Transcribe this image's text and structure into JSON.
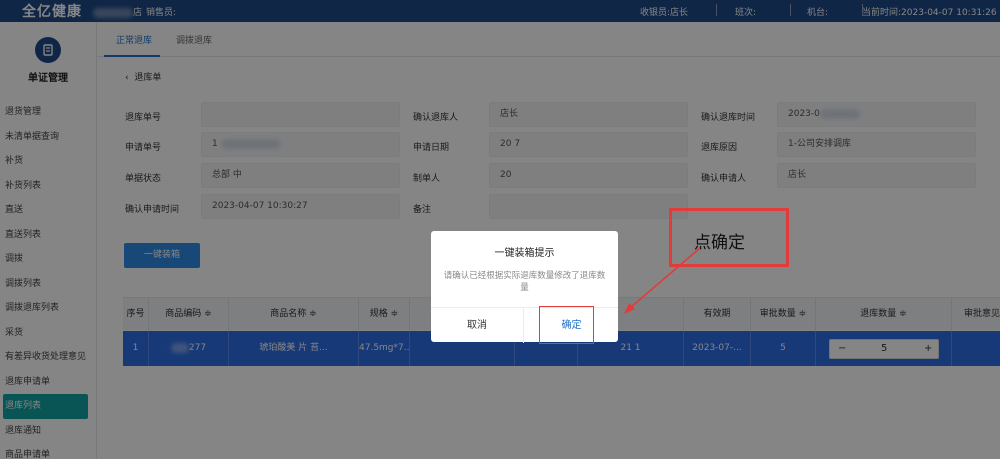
{
  "topbar": {
    "logo": "全亿健康",
    "store_suffix": "店",
    "sales_label": "销售员:",
    "cashier_label": "收银员:",
    "cashier_value": "店长",
    "shift_label": "班次:",
    "terminal_label": "机台:",
    "time_label": "当前时间:",
    "time_value": "2023-04-07 10:31:26"
  },
  "sidebar": {
    "title": "单证管理",
    "items": [
      "退货管理",
      "未清单据查询",
      "补货",
      "补货列表",
      "直送",
      "直送列表",
      "调拨",
      "调拨列表",
      "调拨退库列表",
      "采货",
      "有差异收货处理意见",
      "退库申请单",
      "退库列表",
      "退库通知",
      "商品申请单"
    ],
    "active_index": 12
  },
  "tabs": [
    "正常退库",
    "调拨退库"
  ],
  "back_label": "退库单",
  "form": {
    "return_no_label": "退库单号",
    "return_no_value": "",
    "confirm_person_label": "确认退库人",
    "confirm_person_value": "店长",
    "confirm_time_label": "确认退库时间",
    "confirm_time_value": "2023-0",
    "apply_no_label": "申请单号",
    "apply_no_value": "1",
    "apply_date_label": "申请日期",
    "apply_date_value": "20          7",
    "reason_label": "退库原因",
    "reason_value": "1-公司安排调库",
    "status_label": "单据状态",
    "status_value": "总部          中",
    "maker_label": "制单人",
    "maker_value": "20",
    "confirm_applicant_label": "确认申请人",
    "confirm_applicant_value": "店长",
    "confirm_apply_time_label": "确认申请时间",
    "confirm_apply_time_value": "2023-04-07 10:30:27",
    "remark_label": "备注",
    "remark_value": ""
  },
  "pack_button": "一键装箱",
  "table": {
    "headers": [
      "序号",
      "商品编码 ≑",
      "商品名称 ≑",
      "规格 ≑",
      "",
      "",
      "有效期",
      "审批数量 ≑",
      "退库数量 ≑",
      "审批意见"
    ],
    "row": {
      "index": "1",
      "code": "277",
      "name": "琥珀酸美    片     苔...",
      "spec": "47.5mg*7...",
      "batch": "21      1",
      "expiry": "2023-07-...",
      "approved_qty": "5",
      "return_qty": "5",
      "minus": "−",
      "plus": "+"
    }
  },
  "dialog": {
    "title": "一键装箱提示",
    "message": "请确认已经根据实际退库数量修改了退库数量",
    "cancel": "取消",
    "ok": "确定"
  },
  "annotation": {
    "text": "点确定",
    "color": "#e23b3b"
  }
}
